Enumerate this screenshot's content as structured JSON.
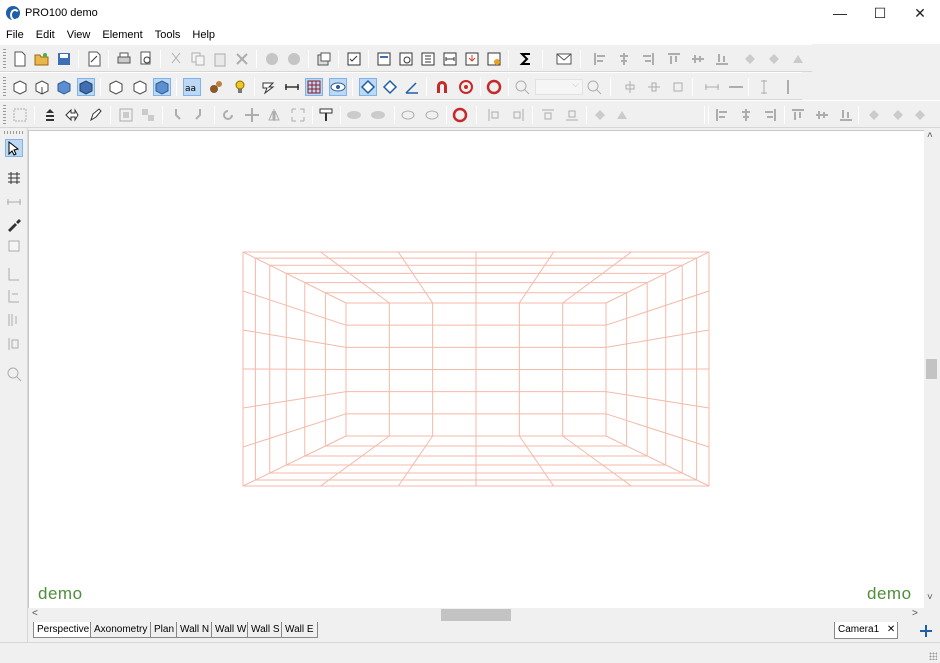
{
  "window": {
    "title": "PRO100 demo",
    "app_icon": "pro100-logo-icon",
    "controls": {
      "minimize": "—",
      "maximize": "☐",
      "close": "✕"
    }
  },
  "menu": [
    {
      "label": "File"
    },
    {
      "label": "Edit"
    },
    {
      "label": "View"
    },
    {
      "label": "Element"
    },
    {
      "label": "Tools"
    },
    {
      "label": "Help"
    }
  ],
  "viewport": {
    "watermark_left": "demo",
    "watermark_right": "demo",
    "grid_color": "#f4b9a8",
    "watermark_color": "#4f8f3a"
  },
  "view_tabs": [
    {
      "label": "Perspective"
    },
    {
      "label": "Axonometry"
    },
    {
      "label": "Plan"
    },
    {
      "label": "Wall N"
    },
    {
      "label": "Wall W"
    },
    {
      "label": "Wall S"
    },
    {
      "label": "Wall E"
    }
  ],
  "camera_tab": {
    "label": "Camera1",
    "close": "✕"
  },
  "add_view_icon": "move-cross-icon",
  "scroll": {
    "up": "˄",
    "down": "˅",
    "left": "<",
    "right": ">"
  }
}
